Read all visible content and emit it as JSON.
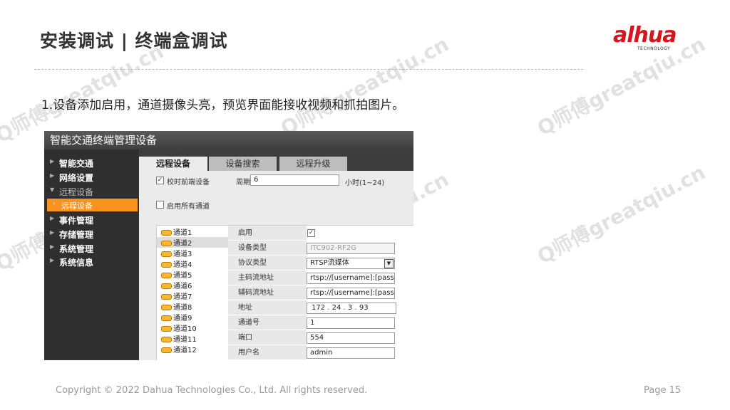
{
  "slide": {
    "title": "安装调试 | 终端盒调试",
    "instruction": "1.设备添加启用，通道摄像头亮，预览界面能接收视频和抓拍图片。",
    "footer_copyright": "Copyright © 2022 Dahua Technologies Co., Ltd. All rights reserved.",
    "page_label": "Page 15",
    "watermark": "Q师傅greatqiu.cn"
  },
  "logo": {
    "wordmark": "alhua",
    "tagline": "TECHNOLOGY",
    "color": "#d7141b"
  },
  "app": {
    "title": "智能交通终端管理设备",
    "sidebar": [
      {
        "label": "智能交通"
      },
      {
        "label": "网络设置"
      },
      {
        "label": "远程设备"
      },
      {
        "label": "远程设备"
      },
      {
        "label": "事件管理"
      },
      {
        "label": "存储管理"
      },
      {
        "label": "系统管理"
      },
      {
        "label": "系统信息"
      }
    ],
    "tabs": [
      {
        "label": "远程设备"
      },
      {
        "label": "设备搜索"
      },
      {
        "label": "远程升级"
      }
    ],
    "sync_label": "校时前端设备",
    "period_label": "周期",
    "period_value": "6",
    "period_unit": "小时(1~24)",
    "enable_all_label": "启用所有通道",
    "channels": [
      "通道1",
      "通道2",
      "通道3",
      "通道4",
      "通道5",
      "通道6",
      "通道7",
      "通道8",
      "通道9",
      "通道10",
      "通道11",
      "通道12"
    ],
    "form": {
      "enable_label": "启用",
      "device_type_label": "设备类型",
      "device_type_value": "ITC902-RF2G",
      "protocol_label": "协议类型",
      "protocol_value": "RTSP流媒体",
      "main_stream_label": "主码流地址",
      "main_stream_value": "rtsp://[username]:[passwor",
      "sub_stream_label": "辅码流地址",
      "sub_stream_value": "rtsp://[username]:[passwor",
      "address_label": "地址",
      "ip": [
        "172",
        "24",
        "3",
        "93"
      ],
      "channel_no_label": "通道号",
      "channel_no_value": "1",
      "port_label": "端口",
      "port_value": "554",
      "user_label": "用户名",
      "user_value": "admin"
    },
    "accent": "#f7931e"
  }
}
